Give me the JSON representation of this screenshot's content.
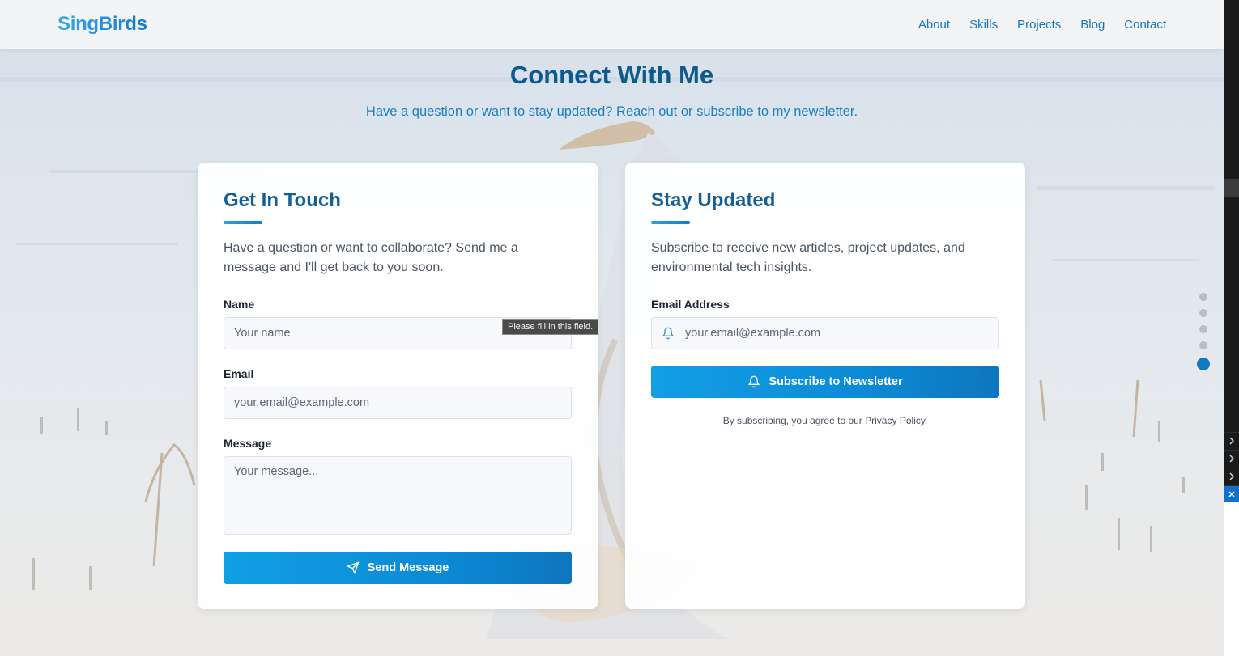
{
  "header": {
    "logo": "SingBirds",
    "nav": [
      "About",
      "Skills",
      "Projects",
      "Blog",
      "Contact"
    ]
  },
  "section": {
    "title": "Connect With Me",
    "subtitle": "Have a question or want to stay updated? Reach out or subscribe to my newsletter."
  },
  "contact_card": {
    "title": "Get In Touch",
    "description": "Have a question or want to collaborate? Send me a message and I'll get back to you soon.",
    "name_label": "Name",
    "name_placeholder": "Your name",
    "email_label": "Email",
    "email_placeholder": "your.email@example.com",
    "message_label": "Message",
    "message_placeholder": "Your message...",
    "submit_label": "Send Message",
    "validation_tooltip": "Please fill in this field."
  },
  "newsletter_card": {
    "title": "Stay Updated",
    "description": "Subscribe to receive new articles, project updates, and environmental tech insights.",
    "email_label": "Email Address",
    "email_placeholder": "your.email@example.com",
    "submit_label": "Subscribe to Newsletter",
    "legal_prefix": "By subscribing, you agree to our ",
    "legal_link": "Privacy Policy",
    "legal_suffix": "."
  },
  "section_dots": {
    "count": 5,
    "active_index": 4
  },
  "colors": {
    "accent": "#1178c4",
    "heading": "#155f94",
    "button_start": "#119fe4",
    "button_end": "#0d76be"
  },
  "icons": {
    "send_button": "paper-plane-icon",
    "newsletter_input": "bell-icon",
    "newsletter_button": "bell-icon"
  }
}
